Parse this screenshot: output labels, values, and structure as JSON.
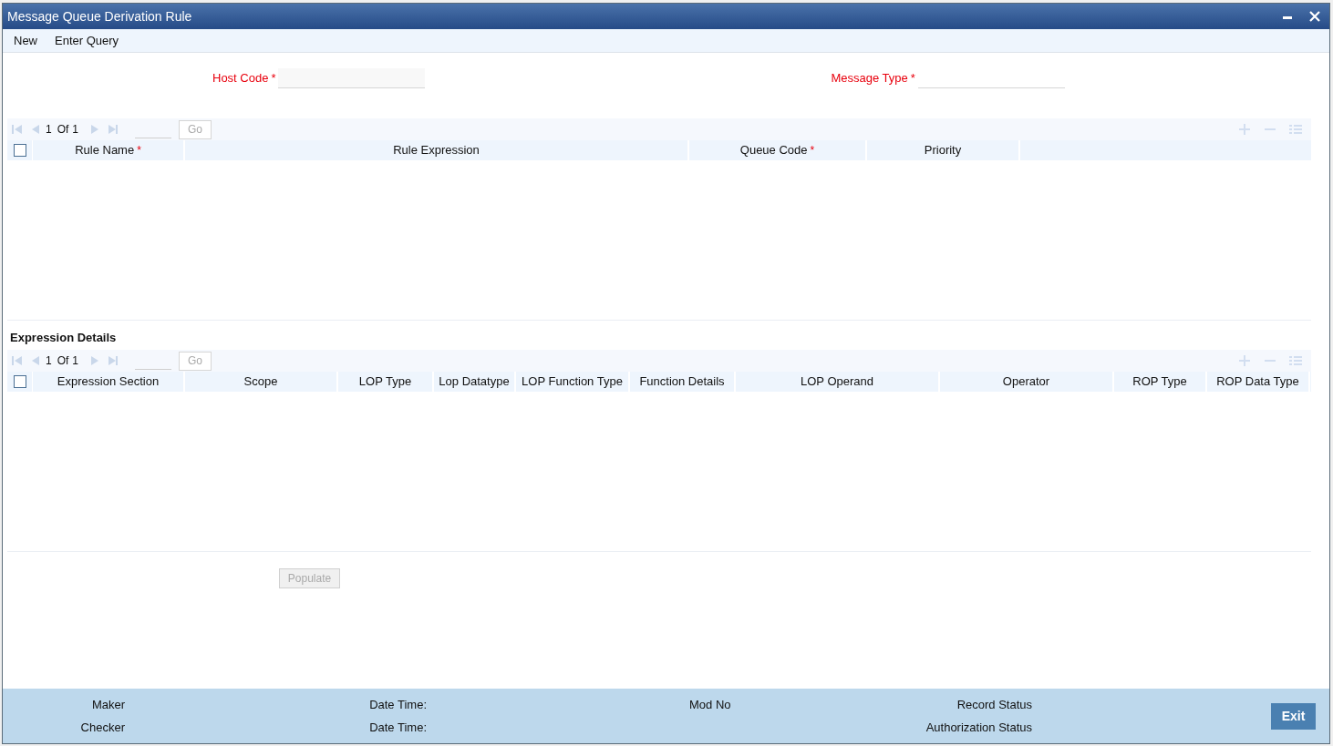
{
  "window": {
    "title": "Message Queue Derivation Rule"
  },
  "menu": [
    "New",
    "Enter Query"
  ],
  "fields": [
    {
      "label": "Host Code",
      "required_marker": "*"
    },
    {
      "label": "Message Type",
      "required_marker": "*"
    }
  ],
  "grids": [
    {
      "pager": {
        "current": "1",
        "of": "Of",
        "total": "1",
        "go": "Go"
      },
      "select_all": {
        "checked": false
      },
      "columns": [
        {
          "label": "Rule Name",
          "required_marker": "*"
        },
        {
          "label": "Rule Expression"
        },
        {
          "label": "Queue Code",
          "required_marker": "*"
        },
        {
          "label": "Priority"
        }
      ]
    },
    {
      "section_title": "Expression Details",
      "pager": {
        "current": "1",
        "of": "Of",
        "total": "1",
        "go": "Go"
      },
      "select_all": {
        "checked": false
      },
      "columns": [
        {
          "label": "Expression Section"
        },
        {
          "label": "Scope"
        },
        {
          "label": "LOP Type"
        },
        {
          "label": "Lop Datatype"
        },
        {
          "label": "LOP Function Type"
        },
        {
          "label": "Function Details"
        },
        {
          "label": "LOP Operand"
        },
        {
          "label": "Operator"
        },
        {
          "label": "ROP Type"
        },
        {
          "label": "ROP Data Type"
        }
      ]
    }
  ],
  "populate_button": {
    "label": "Populate",
    "disabled": true
  },
  "footer": {
    "rows": [
      [
        "Maker",
        "Date Time:",
        "Mod No",
        "Record Status"
      ],
      [
        "Checker",
        "Date Time:",
        "",
        "Authorization Status"
      ]
    ],
    "exit": "Exit"
  }
}
